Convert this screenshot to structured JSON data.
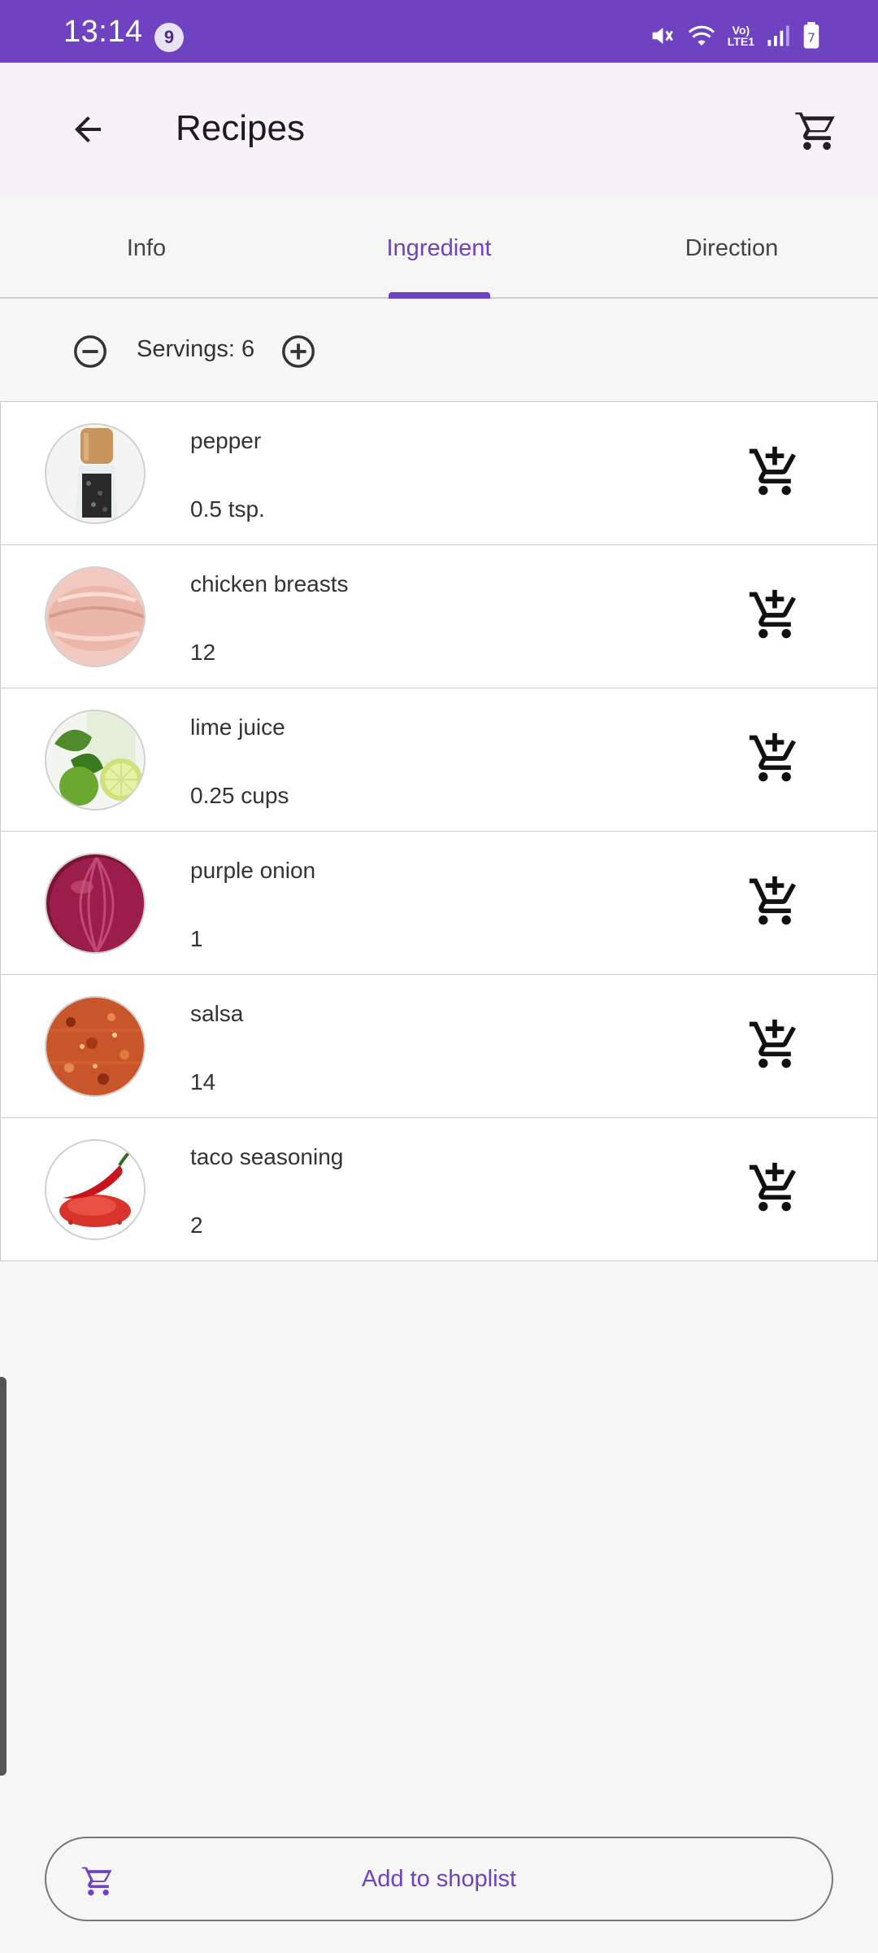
{
  "status_bar": {
    "time": "13:14",
    "badge": "9",
    "network_label": "VoLTE1",
    "battery_level": "7"
  },
  "app_bar": {
    "title": "Recipes",
    "back_icon": "arrow-left-icon",
    "cart_icon": "cart-icon"
  },
  "tabs": [
    {
      "label": "Info",
      "active": false
    },
    {
      "label": "Ingredient",
      "active": true
    },
    {
      "label": "Direction",
      "active": false
    }
  ],
  "servings": {
    "label": "Servings: 6"
  },
  "ingredients": [
    {
      "name": "pepper",
      "quantity": "0.5 tsp.",
      "image": "pepper-grinder"
    },
    {
      "name": "chicken breasts",
      "quantity": "12",
      "image": "raw-chicken"
    },
    {
      "name": "lime juice",
      "quantity": "0.25 cups",
      "image": "limes"
    },
    {
      "name": "purple onion",
      "quantity": "1",
      "image": "red-onion"
    },
    {
      "name": "salsa",
      "quantity": "14",
      "image": "salsa"
    },
    {
      "name": "taco seasoning",
      "quantity": "2",
      "image": "chili-powder"
    }
  ],
  "bottom_button": {
    "label": "Add to shoplist"
  },
  "colors": {
    "accent": "#6f42c1",
    "status_bar": "#6f42c1",
    "app_bar": "#f7f2f7",
    "background": "#f6f6f6"
  }
}
